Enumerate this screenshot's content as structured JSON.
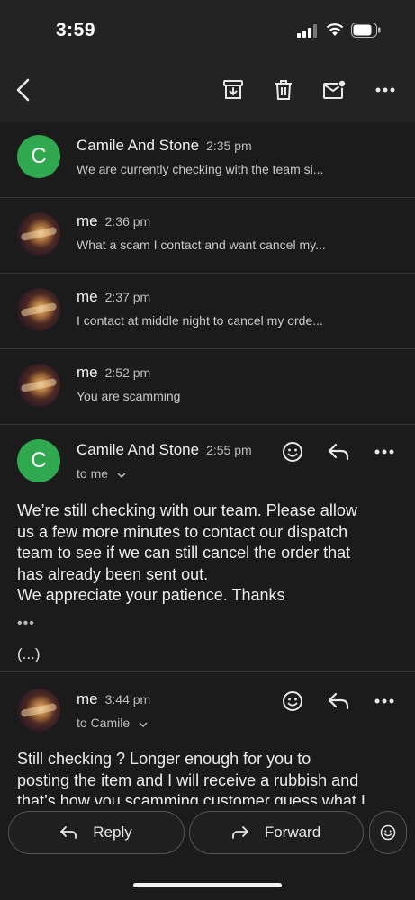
{
  "status": {
    "time": "3:59"
  },
  "toolbar": {
    "back": "back-icon",
    "archive": "archive-icon",
    "delete": "trash-icon",
    "mark_unread": "mail-unread-icon",
    "more": "more-icon"
  },
  "thread": [
    {
      "sender": "Camile And Stone",
      "time": "2:35 pm",
      "snippet": "We are currently checking with the team si...",
      "avatar": "C"
    },
    {
      "sender": "me",
      "time": "2:36 pm",
      "snippet": "What a scam I contact and want cancel my..."
    },
    {
      "sender": "me",
      "time": "2:37 pm",
      "snippet": "I contact at middle night to cancel my orde..."
    },
    {
      "sender": "me",
      "time": "2:52 pm",
      "snippet": "You are scamming"
    }
  ],
  "expanded1": {
    "sender": "Camile And Stone",
    "time": "2:55 pm",
    "avatar": "C",
    "to": "to me",
    "body": [
      "We’re still checking with our team. Please allow",
      "us a few more minutes to contact our dispatch",
      "team to see if we can still cancel the order that",
      "has already been sent out.",
      "We appreciate your patience. Thanks"
    ],
    "dots": "•••",
    "trimmed": "(...)"
  },
  "expanded2": {
    "sender": "me",
    "time": "3:44 pm",
    "to": "to Camile",
    "body": [
      "Still checking ? Longer enough for you to",
      "posting the item and I will receive a rubbish and",
      "that’s how you scamming customer guess what I"
    ]
  },
  "bottom": {
    "reply": "Reply",
    "forward": "Forward"
  }
}
